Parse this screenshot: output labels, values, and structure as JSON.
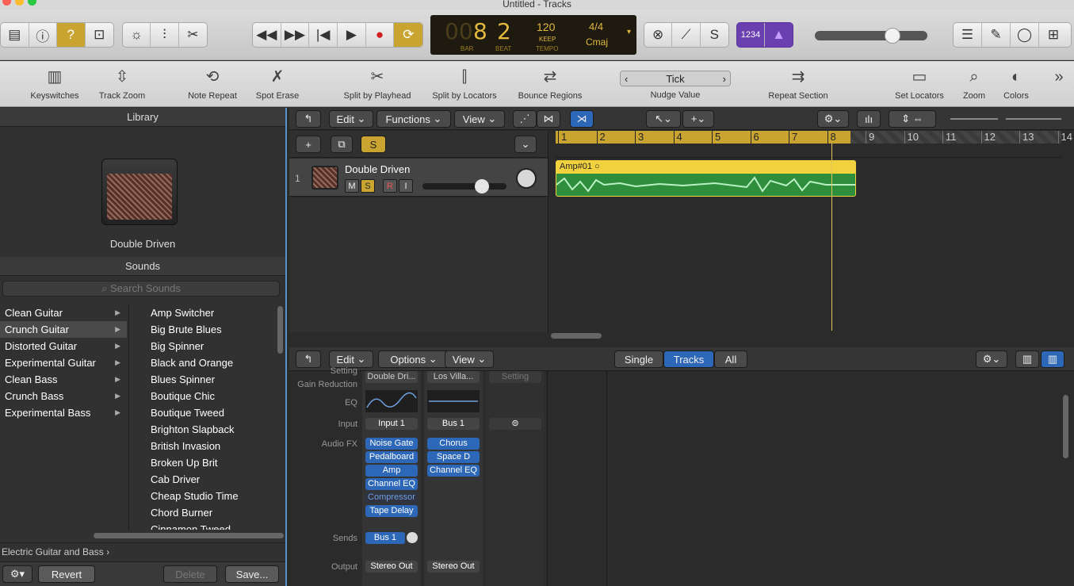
{
  "window": {
    "title": "Untitled - Tracks"
  },
  "lcd": {
    "bar_ghost": "00",
    "bar": "8",
    "beat": "2",
    "bar_label": "BAR",
    "beat_label": "BEAT",
    "tempo": "120",
    "keep": "KEEP",
    "tempo_label": "TEMPO",
    "signature": "4/4",
    "key": "Cmaj"
  },
  "count_in": "1234",
  "toolbar": {
    "keyswitches": "Keyswitches",
    "track_zoom": "Track Zoom",
    "note_repeat": "Note Repeat",
    "spot_erase": "Spot Erase",
    "split_playhead": "Split by Playhead",
    "split_locators": "Split by Locators",
    "bounce_regions": "Bounce Regions",
    "nudge_value": "Nudge Value",
    "nudge_setting": "Tick",
    "repeat_section": "Repeat Section",
    "set_locators": "Set Locators",
    "zoom": "Zoom",
    "colors": "Colors"
  },
  "library": {
    "header": "Library",
    "patch_name": "Double Driven",
    "sounds_header": "Sounds",
    "search_placeholder": "Search Sounds",
    "categories": [
      "Clean Guitar",
      "Crunch Guitar",
      "Distorted Guitar",
      "Experimental Guitar",
      "Clean Bass",
      "Crunch Bass",
      "Experimental Bass"
    ],
    "sounds": [
      "Amp Switcher",
      "Big Brute Blues",
      "Big Spinner",
      "Black and Orange",
      "Blues Spinner",
      "Boutique Chic",
      "Boutique Tweed",
      "Brighton Slapback",
      "British Invasion",
      "Broken Up Brit",
      "Cab Driver",
      "Cheap Studio Time",
      "Chord Burner",
      "Cinnamon Tweed"
    ],
    "path": "Electric Guitar and Bass",
    "revert": "Revert",
    "delete": "Delete",
    "save": "Save..."
  },
  "tracks_menu": {
    "edit": "Edit",
    "functions": "Functions",
    "view": "View"
  },
  "track": {
    "number": "1",
    "name": "Double Driven",
    "m": "M",
    "s": "S",
    "r": "R",
    "i": "I",
    "solo_global": "S"
  },
  "ruler": [
    "1",
    "2",
    "3",
    "4",
    "5",
    "6",
    "7",
    "8",
    "9",
    "10",
    "11",
    "12",
    "13",
    "14"
  ],
  "region": {
    "name": "Amp#01"
  },
  "mixer_menu": {
    "edit": "Edit",
    "options": "Options",
    "view": "View",
    "single": "Single",
    "tracks": "Tracks",
    "all": "All"
  },
  "mixer": {
    "labels": {
      "setting": "Setting",
      "gain_reduction": "Gain Reduction",
      "eq": "EQ",
      "input": "Input",
      "audio_fx": "Audio FX",
      "sends": "Sends",
      "output": "Output"
    },
    "ch1": {
      "setting": "Double Dri...",
      "input": "Input 1",
      "fx": [
        "Noise Gate",
        "Pedalboard",
        "Amp",
        "Channel EQ",
        "Compressor",
        "Tape Delay"
      ],
      "send": "Bus 1",
      "output": "Stereo Out"
    },
    "ch2": {
      "setting": "Los Villa...",
      "input": "Bus 1",
      "fx": [
        "Chorus",
        "Space D",
        "Channel EQ"
      ],
      "output": "Stereo Out"
    },
    "ch3": {
      "setting": "Setting"
    }
  }
}
